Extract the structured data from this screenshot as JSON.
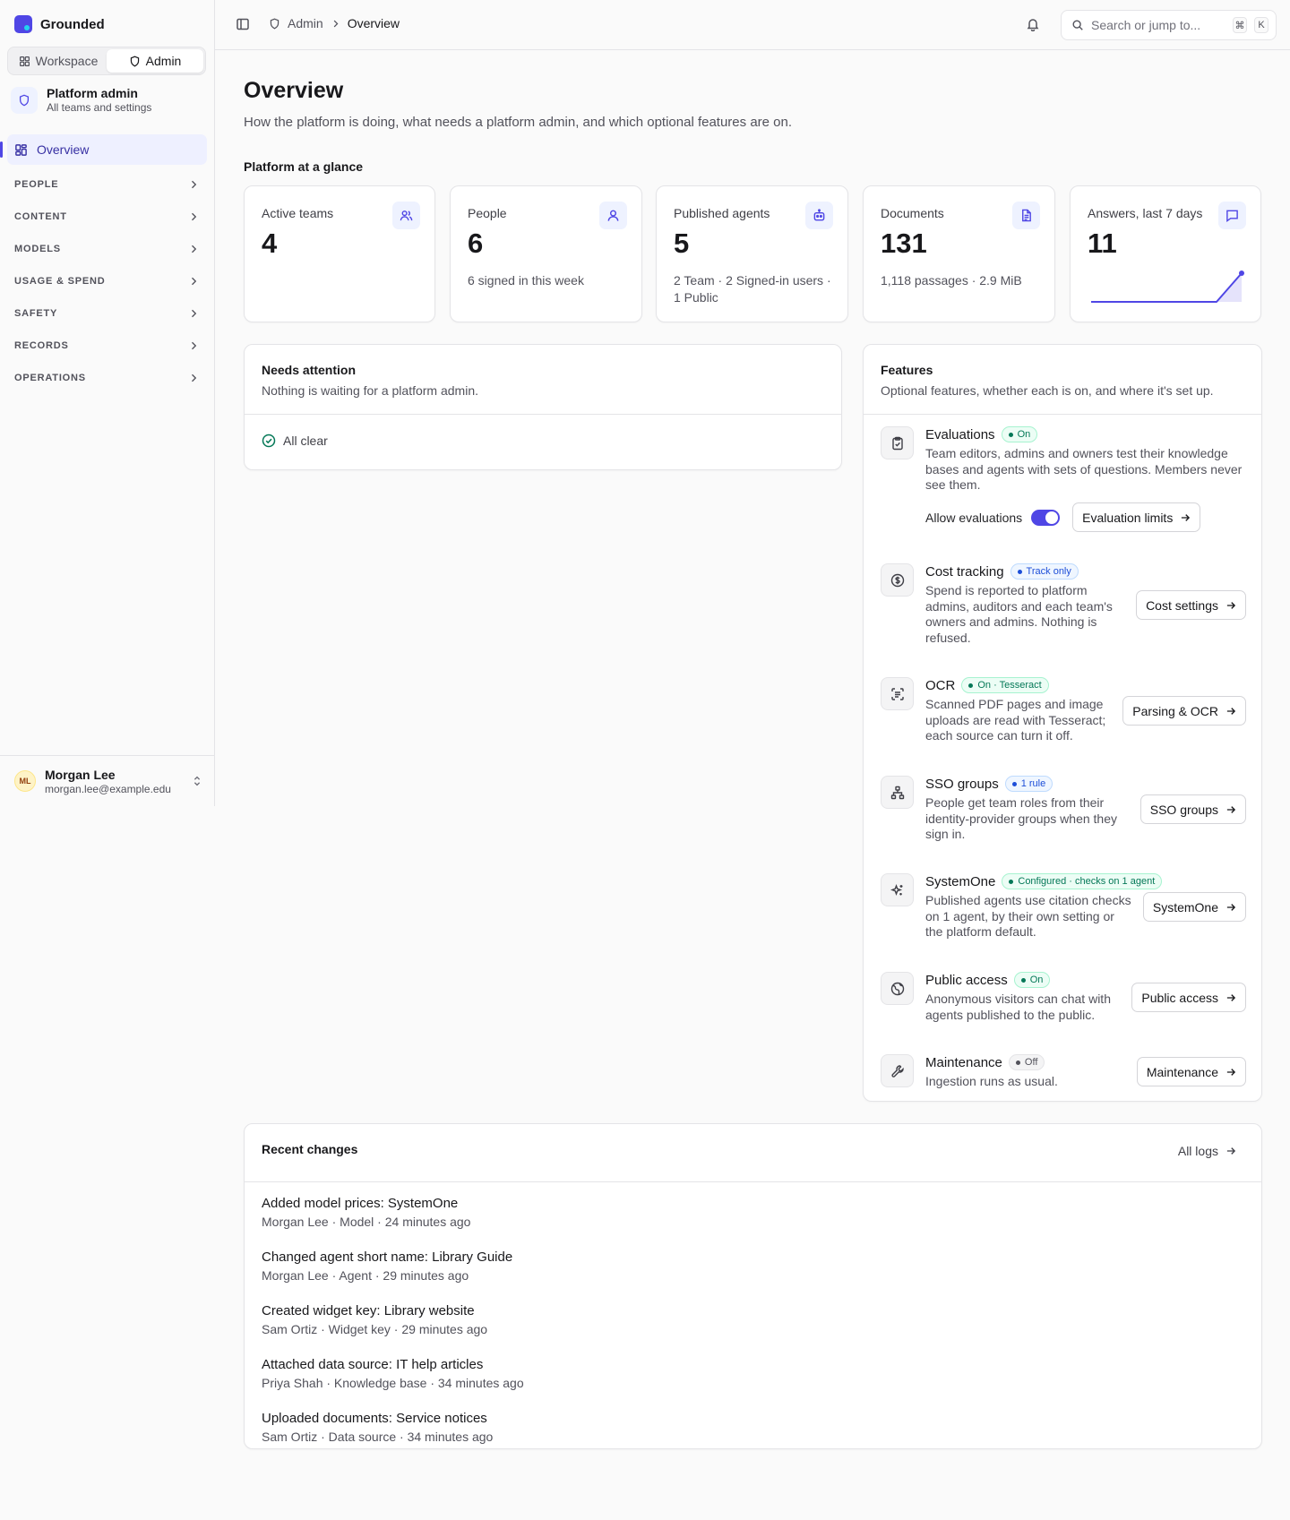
{
  "brand": {
    "name": "Grounded"
  },
  "switcher": {
    "workspace": "Workspace",
    "admin": "Admin"
  },
  "context": {
    "title": "Platform admin",
    "subtitle": "All teams and settings"
  },
  "nav": {
    "active": "Overview",
    "groups": [
      "PEOPLE",
      "CONTENT",
      "MODELS",
      "USAGE & SPEND",
      "SAFETY",
      "RECORDS",
      "OPERATIONS"
    ]
  },
  "user": {
    "initials": "ML",
    "name": "Morgan Lee",
    "email": "morgan.lee@example.edu"
  },
  "topbar": {
    "breadcrumb_root": "Admin",
    "breadcrumb_current": "Overview",
    "search_placeholder": "Search or jump to...",
    "kbd_cmd": "⌘",
    "kbd_k": "K"
  },
  "page": {
    "title": "Overview",
    "subtitle": "How the platform is doing, what needs a platform admin, and which optional features are on.",
    "glance_title": "Platform at a glance"
  },
  "stats": [
    {
      "label": "Active teams",
      "value": "4",
      "sub": "",
      "icon": "users-icon"
    },
    {
      "label": "People",
      "value": "6",
      "sub": "6 signed in this week",
      "icon": "user-icon"
    },
    {
      "label": "Published agents",
      "value": "5",
      "sub": "2 Team · 2 Signed-in users · 1 Public",
      "icon": "bot-icon"
    },
    {
      "label": "Documents",
      "value": "131",
      "sub": "1,118 passages · 2.9 MiB",
      "icon": "document-icon"
    },
    {
      "label": "Answers, last 7 days",
      "value": "11",
      "sub": "",
      "icon": "message-icon"
    }
  ],
  "chart_data": {
    "type": "area",
    "title": "Answers, last 7 days",
    "values": [
      0,
      0,
      0,
      0,
      0,
      0,
      11
    ],
    "color": "#4f46e5"
  },
  "attention": {
    "title": "Needs attention",
    "subtitle": "Nothing is waiting for a platform admin.",
    "status": "All clear"
  },
  "features": {
    "title": "Features",
    "subtitle": "Optional features, whether each is on, and where it's set up.",
    "toggle_label": "Allow evaluations",
    "toggle_on": true,
    "items": [
      {
        "name": "Evaluations",
        "badge": "On",
        "desc": "Team editors, admins and owners test their knowledge bases and agents with sets of questions. Members never see them.",
        "button": "Evaluation limits"
      },
      {
        "name": "Cost tracking",
        "badge": "Track only",
        "desc": "Spend is reported to platform admins, auditors and each team's owners and admins. Nothing is refused.",
        "button": "Cost settings"
      },
      {
        "name": "OCR",
        "badge": "On · Tesseract",
        "desc": "Scanned PDF pages and image uploads are read with Tesseract; each source can turn it off.",
        "button": "Parsing & OCR"
      },
      {
        "name": "SSO groups",
        "badge": "1 rule",
        "desc": "People get team roles from their identity-provider groups when they sign in.",
        "button": "SSO groups"
      },
      {
        "name": "SystemOne",
        "badge": "Configured · checks on 1 agent",
        "desc": "Published agents use citation checks on 1 agent, by their own setting or the platform default.",
        "button": "SystemOne"
      },
      {
        "name": "Public access",
        "badge": "On",
        "desc": "Anonymous visitors can chat with agents published to the public.",
        "button": "Public access"
      },
      {
        "name": "Maintenance",
        "badge": "Off",
        "desc": "Ingestion runs as usual.",
        "button": "Maintenance"
      }
    ]
  },
  "recent": {
    "title": "Recent changes",
    "all_logs": "All logs",
    "items": [
      {
        "title": "Added model prices: SystemOne",
        "meta": "Morgan Lee · Model · 24 minutes ago"
      },
      {
        "title": "Changed agent short name: Library Guide",
        "meta": "Morgan Lee · Agent · 29 minutes ago"
      },
      {
        "title": "Created widget key: Library website",
        "meta": "Sam Ortiz · Widget key · 29 minutes ago"
      },
      {
        "title": "Attached data source: IT help articles",
        "meta": "Priya Shah · Knowledge base · 34 minutes ago"
      },
      {
        "title": "Uploaded documents: Service notices",
        "meta": "Sam Ortiz · Data source · 34 minutes ago"
      }
    ]
  },
  "colors": {
    "accent": "#4f46e5",
    "success": "#047857",
    "info": "#1d4ed8"
  }
}
